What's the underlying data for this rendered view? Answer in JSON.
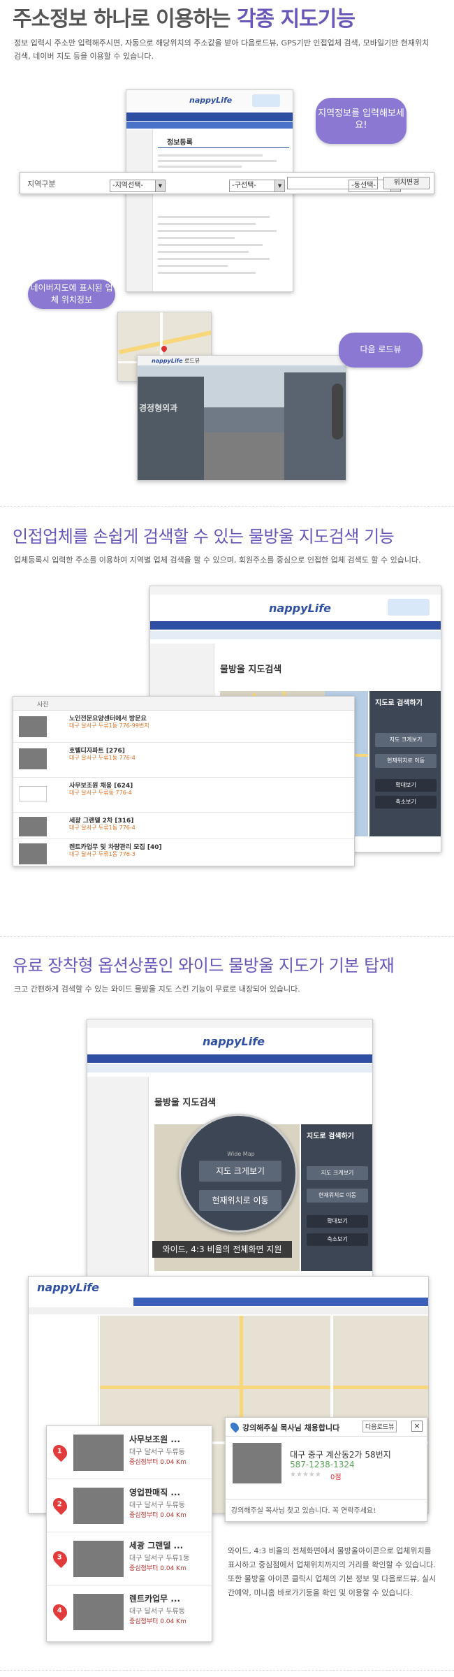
{
  "s1": {
    "title_pre": "주소정보 하나로 이용하는 ",
    "title_em": "각종 지도기능",
    "desc": "정보 입력시 주소만 입력해주시면, 자동으로 해당위치의 주소값을 받아 다음로드뷰, GPS기반 인접업체 검색, 모바일기반 현재위치 검색, 네이버 지도 등을 이용할 수 있습니다.",
    "bubble_input": "지역정보를 입력해보세요!",
    "bubble_naver": "네이버지도에 표시된 업체 위치정보",
    "bubble_roadview": "다음 로드뷰",
    "region_label": "지역구분",
    "sel_city": "-지역선택-",
    "sel_gu": "-구선택-",
    "sel_dong": "-동선택-",
    "loc_button": "위치변경",
    "form_title": "정보등록",
    "logo": "nappyLife",
    "roadview_label": "로드뷰",
    "roadview_sign": "경정형외과"
  },
  "s2": {
    "title": "인접업체를 손쉽게 검색할 수 있는 물방울 지도검색 기능",
    "desc": "업체등록시 입력한 주소를 이용하여 지역별 업체 검색을 할 수 있으며, 회원주소를 중심으로 인접한 업체 검색도 할 수 있습니다.",
    "logo": "nappyLife",
    "page_title": "물방울 지도검색",
    "panel_title": "지도로 검색하기",
    "btn_expand": "지도 크게보기",
    "btn_current": "현재위치로 이동",
    "btn_zoomin": "확대보기",
    "btn_zoomout": "축소보기",
    "list_header": "사진",
    "list": [
      {
        "name": "노인전문요양센터에서 방문요",
        "addr": "대구 달서구 두류1동 776-99번지"
      },
      {
        "name": "호텔디자파트 [276]",
        "addr": "대구 달서구 두류1동 776-4"
      },
      {
        "name": "사무보조원 채용 [624]",
        "addr": "대구 달서구 두류동 776-4"
      },
      {
        "name": "세광 그랜델 2차 [316]",
        "addr": "대구 달서구 두류1동 776-4"
      },
      {
        "name": "렌트카업무 및 차량관리 모집 [40]",
        "addr": "대구 달서구 두류1동 776-3"
      }
    ]
  },
  "s3": {
    "title": "유료 장착형 옵션상품인 와이드 물방울 지도가 기본 탑재",
    "desc": "크고 간편하게 검색할 수 있는 와이드 물방울 지도 스킨 기능이 무료로 내장되어 있습니다.",
    "logo": "nappyLife",
    "page_title": "물방울 지도검색",
    "panel_title": "지도로 검색하기",
    "zoom_caption": "Wide Map",
    "zoom_btn1": "지도 크게보기",
    "zoom_btn2": "현재위치로 이동",
    "btn_expand": "지도 크게보기",
    "btn_current": "현재위치로 이동",
    "btn_zoomin": "확대보기",
    "btn_zoomout": "축소보기",
    "wide_caption": "와이드, 4:3 비율의 전체화면 지원",
    "popup_title": "강의해주실 목사님 채용합니다",
    "popup_roadview": "다음로드뷰",
    "popup_close": "×",
    "popup_addr": "대구 중구 계산동2가 58번지",
    "popup_phone": "587-1238-1324",
    "popup_count": "0점",
    "popup_footer": "강의해주실 목사님 찾고 있습니다. 꼭 연락주세요!",
    "list": [
      {
        "num": "1",
        "name": "사무보조원 ...",
        "addr": "대구 달서구 두류동",
        "dist": "중심점부터 0.04 Km"
      },
      {
        "num": "2",
        "name": "영업판매직 ...",
        "addr": "대구 달서구 두류동",
        "dist": "중심점부터 0.04 Km"
      },
      {
        "num": "3",
        "name": "세광 그랜델 ...",
        "addr": "대구 달서구 두류1동",
        "dist": "중심점부터 0.04 Km"
      },
      {
        "num": "4",
        "name": "렌트카업무 ...",
        "addr": "대구 달서구 두류동",
        "dist": "중심점부터 0.04 Km"
      }
    ],
    "footer_desc": "와이드, 4:3 비율의 전체화면에서 물방울아이콘으로 업체위치를 표시하고 중심점에서 업체위치까지의 거리를 확인할 수 있습니다. 또한 물방울 아이콘 클릭시 업체의 기본 정보 및 다음로드뷰, 실시간예약, 미니홈 바로가기등을 확인 및 이용할 수 있습니다."
  }
}
